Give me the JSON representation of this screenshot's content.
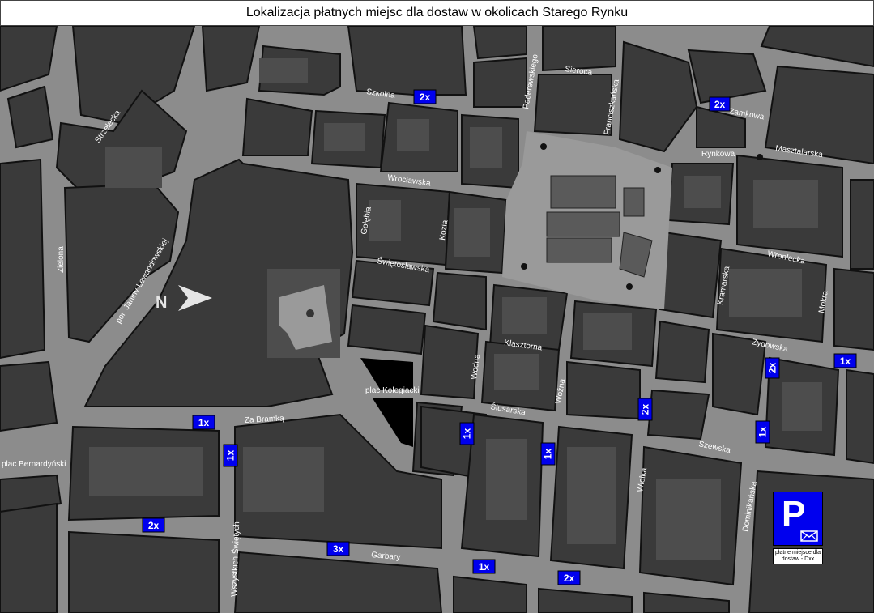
{
  "title": "Lokalizacja płatnych miejsc dla dostaw w okolicach Starego Rynku",
  "colors": {
    "road": "#8c8c8c",
    "block": "#3a3a3a",
    "building": "#4d4d4d",
    "square": "#9a9a9a",
    "badge": "#0000ee"
  },
  "streets": [
    "Szkolna",
    "Paderewskiego",
    "Sieroca",
    "Franciszkańska",
    "Zamkowa",
    "Strzelecka",
    "Rynkowa",
    "Masztalarska",
    "Wrocławska",
    "Gołębia",
    "Kozia",
    "Świętosławska",
    "Wronlecka",
    "Kramarska",
    "Zielona",
    "por. Janiny Lewandowskiej",
    "Żydowska",
    "Klasztorna",
    "plac Kolegiacki",
    "Wodna",
    "Woźna",
    "Ślusarska",
    "Za Bramką",
    "plac Bernardyński",
    "Szewska",
    "Wielka",
    "Dominikańska",
    "Garbary",
    "Wszystkich Świętych",
    "Mokra"
  ],
  "delivery_spots": [
    "2x",
    "2x",
    "1x",
    "2x",
    "1x",
    "2x",
    "1x",
    "1x",
    "1x",
    "1x",
    "2x",
    "3x",
    "1x",
    "2x"
  ],
  "legend": {
    "symbol": "P",
    "caption": "płatne miejsce dla dostaw - Dxx"
  },
  "north_arrow": "N"
}
